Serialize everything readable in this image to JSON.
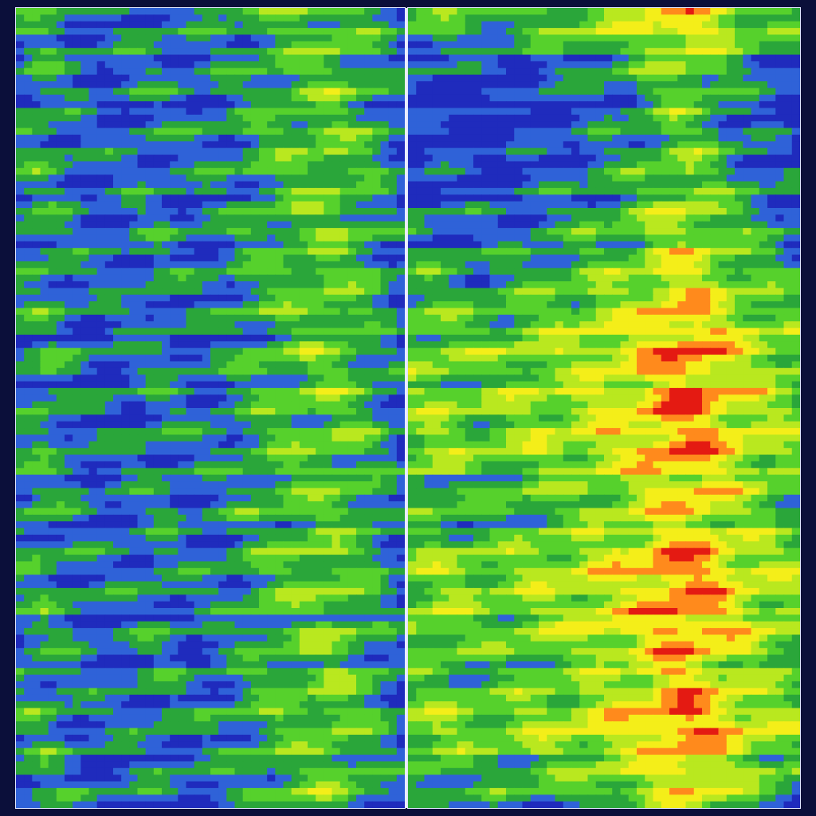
{
  "chart_data": {
    "type": "heatmap",
    "title": "",
    "xlabel": "",
    "ylabel": "",
    "panels": [
      {
        "name": "",
        "rows": 120,
        "cols": 48,
        "column_profile": [
          0.35,
          0.38,
          0.42,
          0.43,
          0.4,
          0.36,
          0.3,
          0.28,
          0.24,
          0.22,
          0.2,
          0.22,
          0.24,
          0.25,
          0.28,
          0.3,
          0.32,
          0.34,
          0.33,
          0.3,
          0.27,
          0.25,
          0.26,
          0.28,
          0.3,
          0.32,
          0.35,
          0.38,
          0.42,
          0.46,
          0.5,
          0.52,
          0.55,
          0.58,
          0.6,
          0.62,
          0.64,
          0.66,
          0.67,
          0.66,
          0.62,
          0.58,
          0.54,
          0.5,
          0.45,
          0.38,
          0.3,
          0.22
        ],
        "row_profile": [
          0.48,
          0.46,
          0.42,
          0.5,
          0.44,
          0.41,
          0.47,
          0.52,
          0.49,
          0.43,
          0.4,
          0.45,
          0.5,
          0.47,
          0.41,
          0.37,
          0.44,
          0.49,
          0.53,
          0.46,
          0.39,
          0.42,
          0.48,
          0.52,
          0.47,
          0.43,
          0.4,
          0.45,
          0.51,
          0.49,
          0.44,
          0.41,
          0.46,
          0.5,
          0.54,
          0.48,
          0.42,
          0.39,
          0.45,
          0.5,
          0.53,
          0.47,
          0.43,
          0.4,
          0.46,
          0.51,
          0.5,
          0.45,
          0.42,
          0.39,
          0.44,
          0.5,
          0.54,
          0.49,
          0.45,
          0.41,
          0.47,
          0.52,
          0.51,
          0.46,
          0.42,
          0.38,
          0.43,
          0.48,
          0.53,
          0.5,
          0.45,
          0.41,
          0.46,
          0.51,
          0.55,
          0.49,
          0.44,
          0.4,
          0.45,
          0.5,
          0.53,
          0.47,
          0.43,
          0.39,
          0.44,
          0.49,
          0.52,
          0.48,
          0.44,
          0.41,
          0.46,
          0.5,
          0.54,
          0.49,
          0.44,
          0.4,
          0.45,
          0.5,
          0.52,
          0.47,
          0.42,
          0.39,
          0.44,
          0.49,
          0.53,
          0.48,
          0.44,
          0.41,
          0.46,
          0.51,
          0.55,
          0.49,
          0.44,
          0.4,
          0.45,
          0.5,
          0.53,
          0.47,
          0.43,
          0.39,
          0.44,
          0.49,
          0.52,
          0.48
        ]
      },
      {
        "name": "",
        "rows": 120,
        "cols": 48,
        "column_profile": [
          0.32,
          0.34,
          0.36,
          0.38,
          0.36,
          0.34,
          0.32,
          0.3,
          0.29,
          0.28,
          0.3,
          0.32,
          0.34,
          0.36,
          0.38,
          0.4,
          0.42,
          0.43,
          0.44,
          0.45,
          0.47,
          0.5,
          0.55,
          0.58,
          0.6,
          0.62,
          0.64,
          0.66,
          0.72,
          0.78,
          0.84,
          0.9,
          0.94,
          0.96,
          0.95,
          0.92,
          0.86,
          0.8,
          0.74,
          0.68,
          0.62,
          0.58,
          0.54,
          0.5,
          0.46,
          0.42,
          0.38,
          0.34
        ],
        "row_profile": [
          0.62,
          0.66,
          0.7,
          0.64,
          0.58,
          0.5,
          0.42,
          0.36,
          0.32,
          0.28,
          0.25,
          0.22,
          0.2,
          0.18,
          0.17,
          0.16,
          0.15,
          0.14,
          0.14,
          0.15,
          0.16,
          0.18,
          0.2,
          0.22,
          0.24,
          0.26,
          0.28,
          0.3,
          0.32,
          0.34,
          0.36,
          0.38,
          0.4,
          0.42,
          0.44,
          0.46,
          0.48,
          0.5,
          0.52,
          0.54,
          0.56,
          0.58,
          0.6,
          0.63,
          0.66,
          0.7,
          0.74,
          0.78,
          0.82,
          0.86,
          0.88,
          0.9,
          0.88,
          0.84,
          0.8,
          0.78,
          0.82,
          0.88,
          0.92,
          0.9,
          0.86,
          0.82,
          0.8,
          0.84,
          0.88,
          0.9,
          0.87,
          0.83,
          0.79,
          0.76,
          0.74,
          0.72,
          0.7,
          0.68,
          0.66,
          0.65,
          0.64,
          0.66,
          0.7,
          0.74,
          0.78,
          0.82,
          0.86,
          0.9,
          0.92,
          0.9,
          0.87,
          0.84,
          0.82,
          0.86,
          0.9,
          0.92,
          0.9,
          0.86,
          0.82,
          0.78,
          0.76,
          0.74,
          0.72,
          0.7,
          0.68,
          0.7,
          0.74,
          0.78,
          0.82,
          0.86,
          0.9,
          0.92,
          0.9,
          0.86,
          0.82,
          0.78,
          0.74,
          0.7,
          0.66,
          0.62,
          0.6,
          0.58,
          0.56,
          0.54
        ]
      }
    ],
    "colormap": [
      "#1f2bbd",
      "#2f62d8",
      "#2aa63a",
      "#56d12c",
      "#b9e81f",
      "#f4ee19",
      "#ff8a1c",
      "#e41a12"
    ],
    "grid": false,
    "legend": "right"
  }
}
